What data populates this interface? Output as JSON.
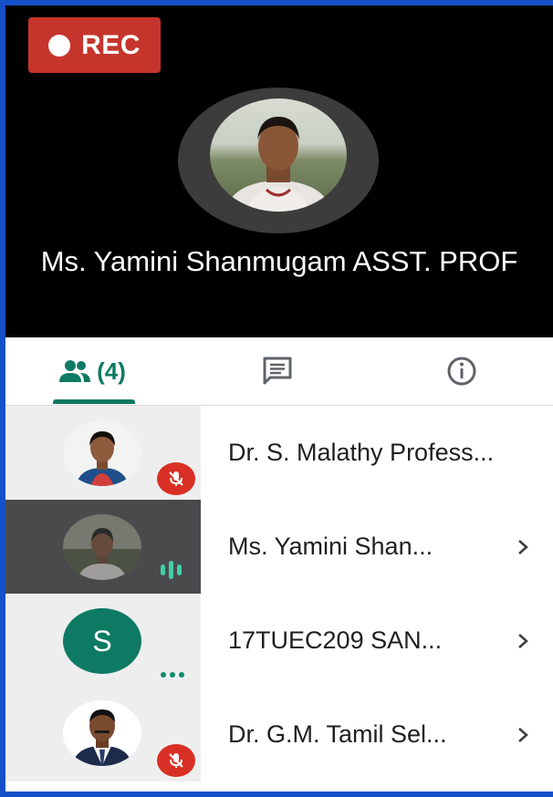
{
  "recording": {
    "label": "REC"
  },
  "speaker": {
    "name": "Ms. Yamini Shanmugam ASST. PROF"
  },
  "tabs": [
    {
      "id": "people",
      "label": "(4)",
      "icon": "people-icon",
      "selected": true
    },
    {
      "id": "chat",
      "icon": "chat-icon",
      "selected": false
    },
    {
      "id": "info",
      "icon": "info-icon",
      "selected": false
    }
  ],
  "participants": [
    {
      "name": "Dr. S. Malathy Profess...",
      "avatar": "photo",
      "mic": "muted",
      "chevron": false
    },
    {
      "name": "Ms. Yamini Shan...",
      "avatar": "photo",
      "mic": "speaking",
      "chevron": true,
      "highlighted": true
    },
    {
      "name": "17TUEC209 SAN...",
      "avatar": "S",
      "mic": "more-dots",
      "chevron": true
    },
    {
      "name": "Dr. G.M. Tamil Sel...",
      "avatar": "photo",
      "mic": "muted",
      "chevron": true
    }
  ],
  "colors": {
    "accent": "#0f7a63",
    "rec": "#c5352c",
    "mute": "#d93025",
    "border": "#1550c8"
  }
}
